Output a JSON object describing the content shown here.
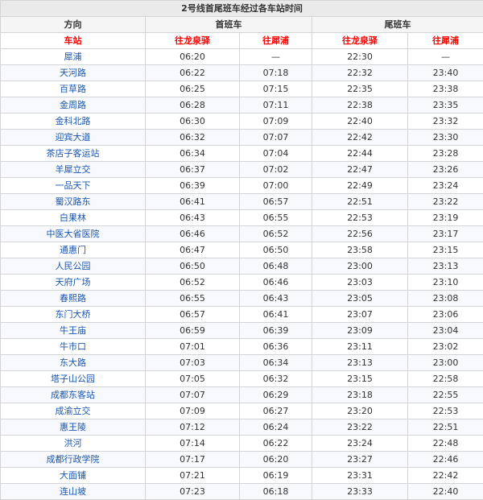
{
  "caption": "2号线首尾班车经过各车站时间",
  "header": {
    "direction_label": "方向",
    "first_train_label": "首班车",
    "last_train_label": "尾班车",
    "station_label": "车站",
    "dir_a": "往龙泉驿",
    "dir_b": "往犀浦"
  },
  "rows": [
    {
      "station": "犀浦",
      "first_a": "06:20",
      "first_b": "—",
      "last_a": "22:30",
      "last_b": "—"
    },
    {
      "station": "天河路",
      "first_a": "06:22",
      "first_b": "07:18",
      "last_a": "22:32",
      "last_b": "23:40"
    },
    {
      "station": "百草路",
      "first_a": "06:25",
      "first_b": "07:15",
      "last_a": "22:35",
      "last_b": "23:38"
    },
    {
      "station": "金周路",
      "first_a": "06:28",
      "first_b": "07:11",
      "last_a": "22:38",
      "last_b": "23:35"
    },
    {
      "station": "金科北路",
      "first_a": "06:30",
      "first_b": "07:09",
      "last_a": "22:40",
      "last_b": "23:32"
    },
    {
      "station": "迎宾大道",
      "first_a": "06:32",
      "first_b": "07:07",
      "last_a": "22:42",
      "last_b": "23:30"
    },
    {
      "station": "茶店子客运站",
      "first_a": "06:34",
      "first_b": "07:04",
      "last_a": "22:44",
      "last_b": "23:28"
    },
    {
      "station": "羊犀立交",
      "first_a": "06:37",
      "first_b": "07:02",
      "last_a": "22:47",
      "last_b": "23:26"
    },
    {
      "station": "一品天下",
      "first_a": "06:39",
      "first_b": "07:00",
      "last_a": "22:49",
      "last_b": "23:24"
    },
    {
      "station": "蜀汉路东",
      "first_a": "06:41",
      "first_b": "06:57",
      "last_a": "22:51",
      "last_b": "23:22"
    },
    {
      "station": "白果林",
      "first_a": "06:43",
      "first_b": "06:55",
      "last_a": "22:53",
      "last_b": "23:19"
    },
    {
      "station": "中医大省医院",
      "first_a": "06:46",
      "first_b": "06:52",
      "last_a": "22:56",
      "last_b": "23:17"
    },
    {
      "station": "通惠门",
      "first_a": "06:47",
      "first_b": "06:50",
      "last_a": "23:58",
      "last_b": "23:15"
    },
    {
      "station": "人民公园",
      "first_a": "06:50",
      "first_b": "06:48",
      "last_a": "23:00",
      "last_b": "23:13"
    },
    {
      "station": "天府广场",
      "first_a": "06:52",
      "first_b": "06:46",
      "last_a": "23:03",
      "last_b": "23:10"
    },
    {
      "station": "春熙路",
      "first_a": "06:55",
      "first_b": "06:43",
      "last_a": "23:05",
      "last_b": "23:08"
    },
    {
      "station": "东门大桥",
      "first_a": "06:57",
      "first_b": "06:41",
      "last_a": "23:07",
      "last_b": "23:06"
    },
    {
      "station": "牛王庙",
      "first_a": "06:59",
      "first_b": "06:39",
      "last_a": "23:09",
      "last_b": "23:04"
    },
    {
      "station": "牛市口",
      "first_a": "07:01",
      "first_b": "06:36",
      "last_a": "23:11",
      "last_b": "23:02"
    },
    {
      "station": "东大路",
      "first_a": "07:03",
      "first_b": "06:34",
      "last_a": "23:13",
      "last_b": "23:00"
    },
    {
      "station": "塔子山公园",
      "first_a": "07:05",
      "first_b": "06:32",
      "last_a": "23:15",
      "last_b": "22:58"
    },
    {
      "station": "成都东客站",
      "first_a": "07:07",
      "first_b": "06:29",
      "last_a": "23:18",
      "last_b": "22:55"
    },
    {
      "station": "成渝立交",
      "first_a": "07:09",
      "first_b": "06:27",
      "last_a": "23:20",
      "last_b": "22:53"
    },
    {
      "station": "惠王陵",
      "first_a": "07:12",
      "first_b": "06:24",
      "last_a": "23:22",
      "last_b": "22:51"
    },
    {
      "station": "洪河",
      "first_a": "07:14",
      "first_b": "06:22",
      "last_a": "23:24",
      "last_b": "22:48"
    },
    {
      "station": "成都行政学院",
      "first_a": "07:17",
      "first_b": "06:20",
      "last_a": "23:27",
      "last_b": "22:46"
    },
    {
      "station": "大面铺",
      "first_a": "07:21",
      "first_b": "06:19",
      "last_a": "23:31",
      "last_b": "22:42"
    },
    {
      "station": "连山坡",
      "first_a": "07:23",
      "first_b": "06:18",
      "last_a": "23:33",
      "last_b": "22:40"
    }
  ]
}
